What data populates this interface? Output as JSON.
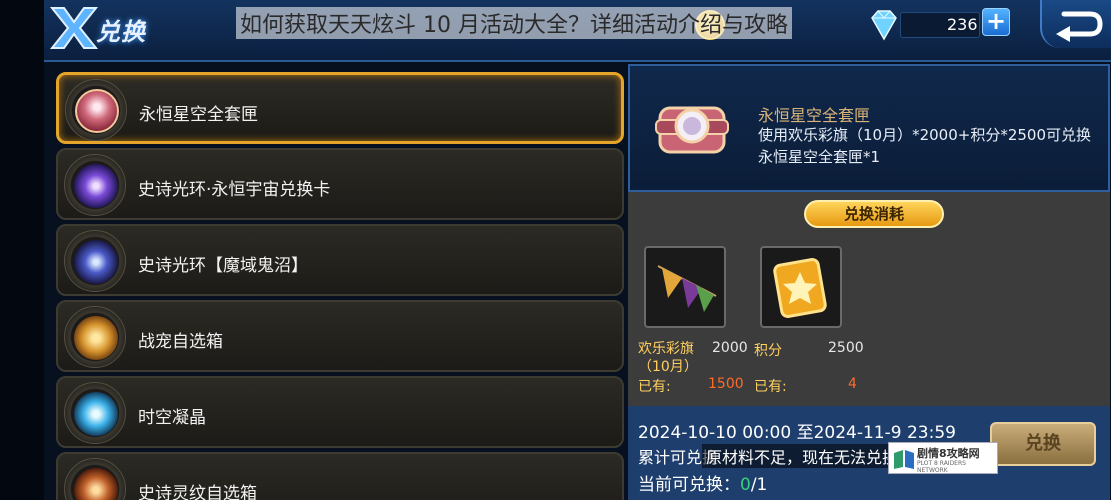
{
  "header": {
    "page_label": "兑换",
    "overlay_title": "如何获取天天炫斗 10 月活动大全？详细活动介绍与攻略",
    "currency_amount": "236",
    "add_button": "+",
    "icons": [
      "x-logo-icon",
      "gold-coin-icon",
      "diamond-icon",
      "back-arrow-icon"
    ]
  },
  "items": [
    {
      "label": "永恒星空全套匣",
      "icon": "chest-pink-icon",
      "selected": true
    },
    {
      "label": "史诗光环·永恒宇宙兑换卡",
      "icon": "cosmic-halo-icon",
      "selected": false
    },
    {
      "label": "史诗光环【魔域鬼沼】",
      "icon": "ghost-halo-icon",
      "selected": false
    },
    {
      "label": "战宠自选箱",
      "icon": "pet-chest-icon",
      "selected": false
    },
    {
      "label": "时空凝晶",
      "icon": "crystal-orb-icon",
      "selected": false
    },
    {
      "label": "史诗灵纹自选箱",
      "icon": "rune-chest-icon",
      "selected": false
    }
  ],
  "detail": {
    "name": "永恒星空全套匣",
    "description": "使用欢乐彩旗（10月）*2000+积分*2500可兑换永恒星空全套匣*1"
  },
  "cost": {
    "tab_label": "兑换消耗",
    "materials": [
      {
        "name": "欢乐彩旗（10月）",
        "required": "2000",
        "owned_label": "已有:",
        "owned": "1500",
        "icon": "festival-flag-icon"
      },
      {
        "name": "积分",
        "required": "2500",
        "owned_label": "已有:",
        "owned": "4",
        "icon": "star-card-icon"
      }
    ]
  },
  "bottom": {
    "date_range": "2024-10-10 00:00 至2024-11-9 23:59",
    "accumulated_prefix": "累计可兑换",
    "warning": "原材料不足，现在无法兑换",
    "current_label": "当前可兑换：",
    "current_value": "0",
    "current_total": "/1",
    "exchange_button": "兑换"
  },
  "watermark": {
    "main": "剧情8攻略网",
    "sub": "PLOT 8 RAIDERS NETWORK"
  },
  "colors": {
    "selected_border": "#e5a52a",
    "gold_text": "#ffd060",
    "owned_red": "#ff6a2a",
    "remaining_green": "#34d07a"
  }
}
